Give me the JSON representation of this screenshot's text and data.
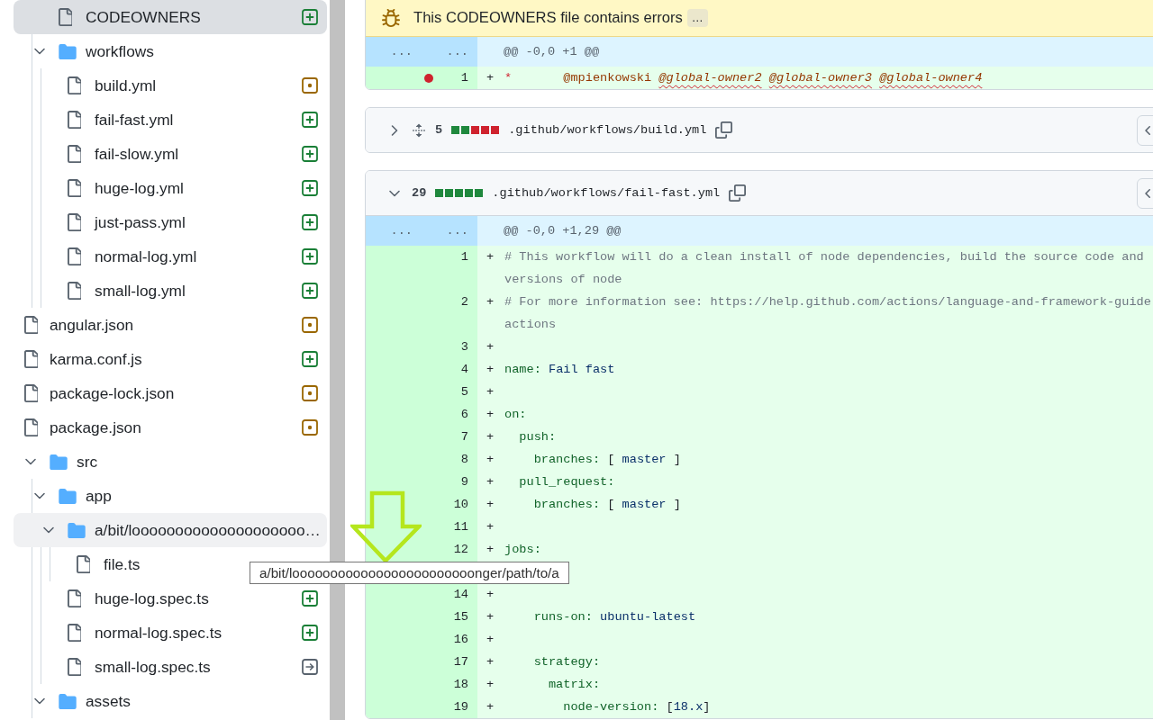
{
  "sidebar": {
    "tree": [
      {
        "kind": "folder",
        "children": [
          {
            "kind": "file",
            "name": "CODEOWNERS",
            "change": {
              "kind": "added"
            },
            "selected": true,
            "hovered": false
          },
          {
            "kind": "folder",
            "name": "workflows",
            "expanded": true,
            "selected": false,
            "hovered": false,
            "children": [
              {
                "kind": "file",
                "name": "build.yml",
                "change": {
                  "kind": "modified"
                },
                "selected": false,
                "hovered": false
              },
              {
                "kind": "file",
                "name": "fail-fast.yml",
                "change": {
                  "kind": "added"
                },
                "selected": false,
                "hovered": false
              },
              {
                "kind": "file",
                "name": "fail-slow.yml",
                "change": {
                  "kind": "added"
                },
                "selected": false,
                "hovered": false
              },
              {
                "kind": "file",
                "name": "huge-log.yml",
                "change": {
                  "kind": "added"
                },
                "selected": false,
                "hovered": false
              },
              {
                "kind": "file",
                "name": "just-pass.yml",
                "change": {
                  "kind": "added"
                },
                "selected": false,
                "hovered": false
              },
              {
                "kind": "file",
                "name": "normal-log.yml",
                "change": {
                  "kind": "added"
                },
                "selected": false,
                "hovered": false
              },
              {
                "kind": "file",
                "name": "small-log.yml",
                "change": {
                  "kind": "added"
                },
                "selected": false,
                "hovered": false
              }
            ]
          }
        ]
      },
      {
        "kind": "file",
        "name": "angular.json",
        "change": {
          "kind": "modified"
        },
        "selected": false,
        "hovered": false
      },
      {
        "kind": "file",
        "name": "karma.conf.js",
        "change": {
          "kind": "added"
        },
        "selected": false,
        "hovered": false
      },
      {
        "kind": "file",
        "name": "package-lock.json",
        "change": {
          "kind": "modified"
        },
        "selected": false,
        "hovered": false
      },
      {
        "kind": "file",
        "name": "package.json",
        "change": {
          "kind": "modified"
        },
        "selected": false,
        "hovered": false
      },
      {
        "kind": "folder",
        "name": "src",
        "expanded": true,
        "selected": false,
        "hovered": false,
        "children": [
          {
            "kind": "folder",
            "name": "app",
            "expanded": true,
            "selected": false,
            "hovered": false,
            "children": [
              {
                "kind": "folder",
                "name": "a/bit/loooooooooooooooooooo…",
                "expanded": true,
                "selected": false,
                "hovered": true,
                "children": [
                  {
                    "kind": "file",
                    "name": "file.ts",
                    "selected": false,
                    "hovered": false
                  }
                ]
              },
              {
                "kind": "file",
                "name": "huge-log.spec.ts",
                "change": {
                  "kind": "added"
                },
                "selected": false,
                "hovered": false
              },
              {
                "kind": "file",
                "name": "normal-log.spec.ts",
                "change": {
                  "kind": "added"
                },
                "selected": false,
                "hovered": false
              },
              {
                "kind": "file",
                "name": "small-log.spec.ts",
                "change": {
                  "kind": "renamed"
                },
                "selected": false,
                "hovered": false
              }
            ]
          },
          {
            "kind": "folder",
            "name": "assets",
            "expanded": true,
            "selected": false,
            "hovered": false
          }
        ]
      }
    ]
  },
  "diff_files": [
    {
      "banner": {
        "text": "This CODEOWNERS file contains errors",
        "more": "…"
      },
      "hunk": {
        "gutter": [
          "...",
          "..."
        ],
        "header": "@@ -0,0 +1 @@"
      },
      "lines": [
        {
          "kind": "added",
          "number": "1",
          "sign": "+",
          "error": true,
          "tokens": [
            {
              "kind": "glob",
              "text": "*"
            },
            {
              "kind": "owner",
              "text": "       @mpienkowski"
            },
            {
              "kind": "owner",
              "text": " @global-owner2",
              "invalid": true
            },
            {
              "kind": "owner",
              "text": " @global-owner3",
              "invalid": true
            },
            {
              "kind": "owner",
              "text": " @global-owner4",
              "invalid": true
            }
          ]
        }
      ]
    },
    {
      "expanded": false,
      "unfold": true,
      "count": "5",
      "diffstat": [
        {
          "kind": "added"
        },
        {
          "kind": "added"
        },
        {
          "kind": "deleted"
        },
        {
          "kind": "deleted"
        },
        {
          "kind": "deleted"
        }
      ],
      "path": ".github/workflows/build.yml"
    },
    {
      "expanded": true,
      "unfold": false,
      "count": "29",
      "diffstat": [
        {
          "kind": "added"
        },
        {
          "kind": "added"
        },
        {
          "kind": "added"
        },
        {
          "kind": "added"
        },
        {
          "kind": "added"
        }
      ],
      "path": ".github/workflows/fail-fast.yml",
      "hunk": {
        "gutter": [
          "...",
          "..."
        ],
        "header": "@@ -0,0 +1,29 @@"
      },
      "lines": [
        {
          "kind": "added",
          "number": "1",
          "sign": "+",
          "tokens": [
            {
              "kind": "comment",
              "text": "# This workflow will do a clean install of node dependencies, build the source code and"
            }
          ],
          "wrap": [
            {
              "kind": "comment",
              "text": "versions of node"
            }
          ]
        },
        {
          "kind": "added",
          "number": "2",
          "sign": "+",
          "tokens": [
            {
              "kind": "comment",
              "text": "# For more information see: https://help.github.com/actions/language-and-framework-guide"
            }
          ],
          "wrap": [
            {
              "kind": "comment",
              "text": "actions"
            }
          ]
        },
        {
          "kind": "added",
          "number": "3",
          "sign": "+"
        },
        {
          "kind": "added",
          "number": "4",
          "sign": "+",
          "tokens": [
            {
              "kind": "key",
              "text": "name:"
            },
            {
              "kind": "value",
              "text": " Fail fast"
            }
          ]
        },
        {
          "kind": "added",
          "number": "5",
          "sign": "+"
        },
        {
          "kind": "added",
          "number": "6",
          "sign": "+",
          "tokens": [
            {
              "kind": "key",
              "text": "on:"
            }
          ]
        },
        {
          "kind": "added",
          "number": "7",
          "sign": "+",
          "tokens": [
            {
              "kind": "key",
              "text": "  push:"
            }
          ]
        },
        {
          "kind": "added",
          "number": "8",
          "sign": "+",
          "tokens": [
            {
              "kind": "key",
              "text": "    branches:"
            },
            {
              "kind": "punct",
              "text": " ["
            },
            {
              "kind": "value",
              "text": " master"
            },
            {
              "kind": "punct",
              "text": " ]"
            }
          ]
        },
        {
          "kind": "added",
          "number": "9",
          "sign": "+",
          "tokens": [
            {
              "kind": "key",
              "text": "  pull_request:"
            }
          ]
        },
        {
          "kind": "added",
          "number": "10",
          "sign": "+",
          "tokens": [
            {
              "kind": "key",
              "text": "    branches:"
            },
            {
              "kind": "punct",
              "text": " ["
            },
            {
              "kind": "value",
              "text": " master"
            },
            {
              "kind": "punct",
              "text": " ]"
            }
          ]
        },
        {
          "kind": "added",
          "number": "11",
          "sign": "+"
        },
        {
          "kind": "added",
          "number": "12",
          "sign": "+",
          "tokens": [
            {
              "kind": "key",
              "text": "jobs:"
            }
          ]
        },
        {
          "kind": "covered"
        },
        {
          "kind": "added",
          "number": "14",
          "sign": "+"
        },
        {
          "kind": "added",
          "number": "15",
          "sign": "+",
          "tokens": [
            {
              "kind": "key",
              "text": "    runs-on:"
            },
            {
              "kind": "value",
              "text": " ubuntu-latest"
            }
          ]
        },
        {
          "kind": "added",
          "number": "16",
          "sign": "+"
        },
        {
          "kind": "added",
          "number": "17",
          "sign": "+",
          "tokens": [
            {
              "kind": "key",
              "text": "    strategy:"
            }
          ]
        },
        {
          "kind": "added",
          "number": "18",
          "sign": "+",
          "tokens": [
            {
              "kind": "key",
              "text": "      matrix:"
            }
          ]
        },
        {
          "kind": "added",
          "number": "19",
          "sign": "+",
          "tokens": [
            {
              "kind": "key",
              "text": "        node-version:"
            },
            {
              "kind": "punct",
              "text": " ["
            },
            {
              "kind": "value",
              "text": "18.x"
            },
            {
              "kind": "punct",
              "text": "]"
            }
          ]
        }
      ]
    }
  ],
  "tooltip": {
    "text": "a/bit/loooooooooooooooooooooooonger/path/to/a"
  }
}
